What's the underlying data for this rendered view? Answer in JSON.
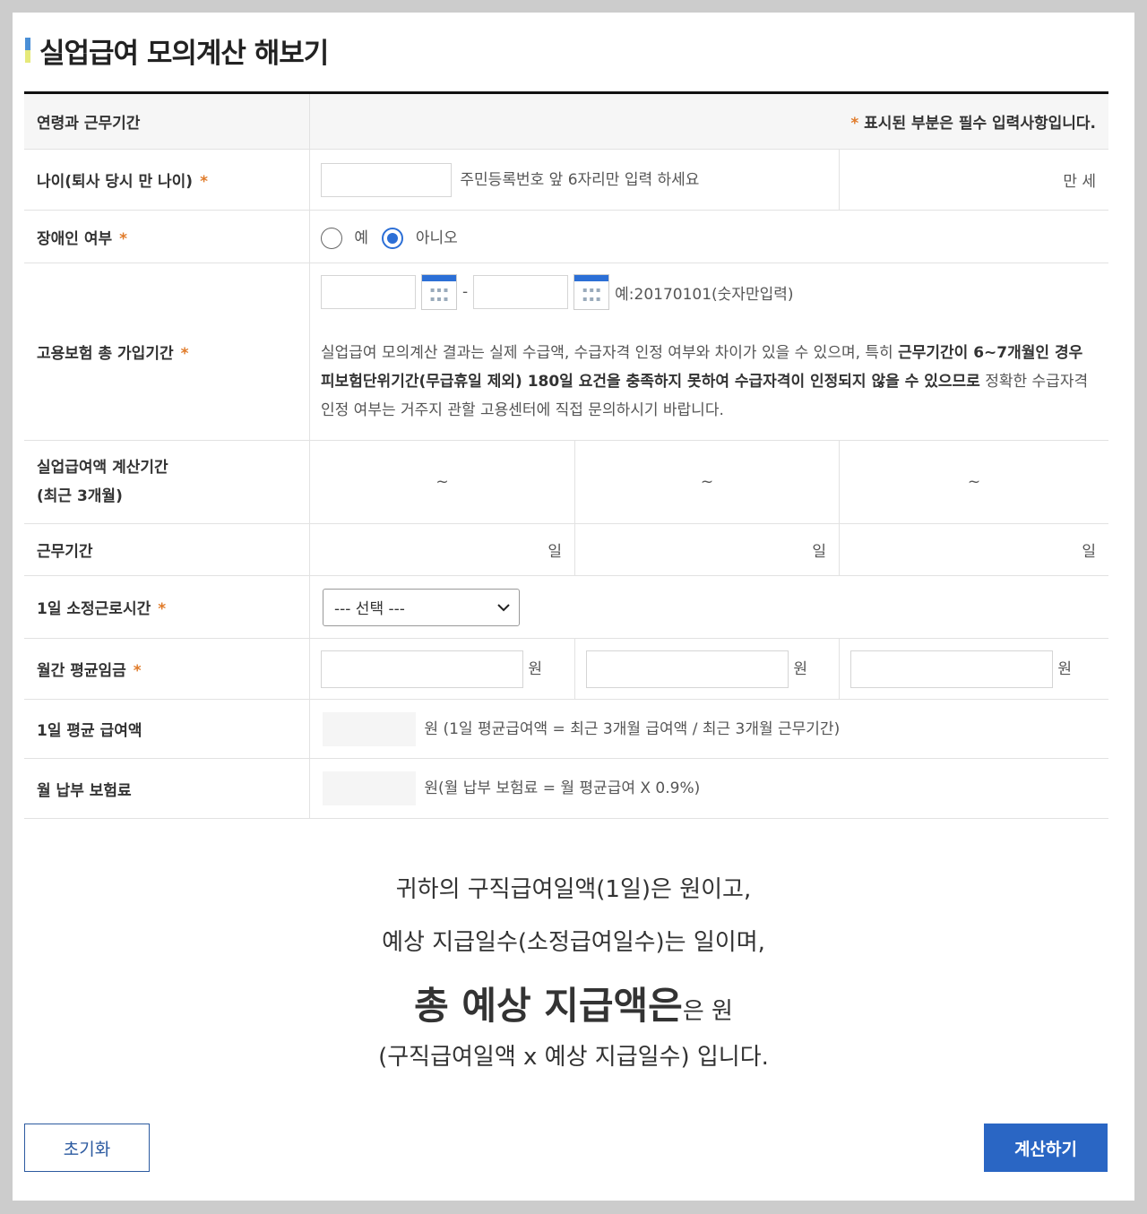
{
  "title": "실업급여 모의계산 해보기",
  "header": {
    "label": "연령과 근무기간",
    "required_note": "표시된 부분은 필수 입력사항입니다.",
    "star": "*"
  },
  "age": {
    "label": "나이(퇴사 당시 만 나이)",
    "hint": "주민등록번호 앞 6자리만 입력 하세요",
    "unit": "만 세"
  },
  "disabled": {
    "label": "장애인 여부",
    "yes": "예",
    "no": "아니오",
    "selected": "아니오"
  },
  "insurance": {
    "label": "고용보험 총 가입기간",
    "dash": "-",
    "example": "예:20170101(숫자만입력)",
    "notice_a": "실업급여 모의계산 결과는 실제 수급액, 수급자격 인정 여부와 차이가 있을 수 있으며, 특히 ",
    "notice_bold": "근무기간이 6~7개월인 경우 피보험단위기간(무급휴일 제외) 180일 요건을 충족하지 못하여 수급자격이 인정되지 않을 수 있으므로",
    "notice_b": " 정확한 수급자격 인정 여부는 거주지 관할 고용센터에 직접 문의하시기 바랍니다."
  },
  "calc_period": {
    "label_line1": "실업급여액 계산기간",
    "label_line2": "(최근 3개월)",
    "values": [
      "~",
      "~",
      "~"
    ]
  },
  "work_days": {
    "label": "근무기간",
    "unit": "일"
  },
  "daily_hours": {
    "label": "1일 소정근로시간",
    "selected": "--- 선택 ---"
  },
  "monthly_wage": {
    "label": "월간 평균임금",
    "unit": "원"
  },
  "daily_benefit": {
    "label": "1일 평균 급여액",
    "formula": "원 (1일 평균급여액 = 최근 3개월 급여액 / 최근 3개월 근무기간)"
  },
  "monthly_premium": {
    "label": "월 납부 보험료",
    "formula": "원(월 납부 보험료 = 월 평균급여 X 0.9%)"
  },
  "result": {
    "line1": "귀하의 구직급여일액(1일)은 원이고,",
    "line2": "예상 지급일수(소정급여일수)는 일이며,",
    "line3_big": "총 예상 지급액은",
    "line3_small": "은 원",
    "line4": "(구직급여일액 x 예상 지급일수) 입니다."
  },
  "buttons": {
    "reset": "초기화",
    "calculate": "계산하기"
  },
  "icons": {
    "calendar": "calendar-icon",
    "dropdown": "chevron-down-icon"
  },
  "colors": {
    "accent": "#2a66c4",
    "required": "#e07b2a"
  }
}
